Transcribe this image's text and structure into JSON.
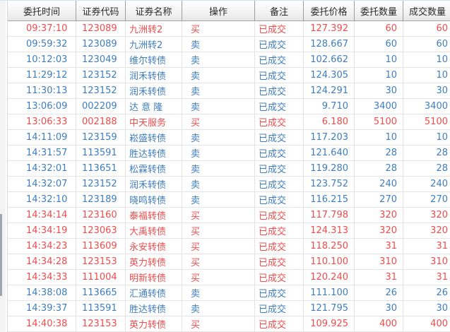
{
  "colors": {
    "buy_red": "#ef4c4c",
    "sell_blue": "#3e7dbd",
    "header_text": "#2a2a2a",
    "row_border": "#e5e5e5"
  },
  "table": {
    "columns": [
      "委托时间",
      "证券代码",
      "证券名称",
      "操作",
      "备注",
      "委托价格",
      "委托数量",
      "成交数量"
    ],
    "rows": [
      {
        "time": "09:37:10",
        "code": "123089",
        "name": "九洲转2",
        "action": "买",
        "note": "已成交",
        "price": "127.392",
        "qty": "60",
        "filled": "60",
        "direction": "buy"
      },
      {
        "time": "09:59:32",
        "code": "123089",
        "name": "九洲转2",
        "action": "卖",
        "note": "已成交",
        "price": "128.667",
        "qty": "60",
        "filled": "60",
        "direction": "sell"
      },
      {
        "time": "10:12:03",
        "code": "123049",
        "name": "维尔转债",
        "action": "卖",
        "note": "已成交",
        "price": "102.662",
        "qty": "10",
        "filled": "10",
        "direction": "sell"
      },
      {
        "time": "11:29:12",
        "code": "123152",
        "name": "润禾转债",
        "action": "卖",
        "note": "已成交",
        "price": "124.305",
        "qty": "10",
        "filled": "10",
        "direction": "sell"
      },
      {
        "time": "11:30:13",
        "code": "123152",
        "name": "润禾转债",
        "action": "卖",
        "note": "已成交",
        "price": "124.291",
        "qty": "30",
        "filled": "30",
        "direction": "sell"
      },
      {
        "time": "13:06:09",
        "code": "002209",
        "name": "达 意 隆",
        "action": "卖",
        "note": "已成交",
        "price": "9.710",
        "qty": "3400",
        "filled": "3400",
        "direction": "sell"
      },
      {
        "time": "13:06:33",
        "code": "002188",
        "name": "中天服务",
        "action": "买",
        "note": "已成交",
        "price": "6.180",
        "qty": "5100",
        "filled": "5100",
        "direction": "buy"
      },
      {
        "time": "14:11:09",
        "code": "123159",
        "name": "崧盛转债",
        "action": "卖",
        "note": "已成交",
        "price": "117.203",
        "qty": "10",
        "filled": "10",
        "direction": "sell"
      },
      {
        "time": "14:31:57",
        "code": "113591",
        "name": "胜达转债",
        "action": "卖",
        "note": "已成交",
        "price": "121.640",
        "qty": "28",
        "filled": "28",
        "direction": "sell"
      },
      {
        "time": "14:32:01",
        "code": "113651",
        "name": "松霖转债",
        "action": "卖",
        "note": "已成交",
        "price": "119.280",
        "qty": "28",
        "filled": "28",
        "direction": "sell"
      },
      {
        "time": "14:32:07",
        "code": "123152",
        "name": "润禾转债",
        "action": "卖",
        "note": "已成交",
        "price": "123.752",
        "qty": "240",
        "filled": "240",
        "direction": "sell"
      },
      {
        "time": "14:32:10",
        "code": "123189",
        "name": "晓鸣转债",
        "action": "卖",
        "note": "已成交",
        "price": "116.215",
        "qty": "270",
        "filled": "270",
        "direction": "sell"
      },
      {
        "time": "14:34:14",
        "code": "123160",
        "name": "泰福转债",
        "action": "买",
        "note": "已成交",
        "price": "117.798",
        "qty": "320",
        "filled": "320",
        "direction": "buy"
      },
      {
        "time": "14:34:19",
        "code": "123063",
        "name": "大禹转债",
        "action": "买",
        "note": "已成交",
        "price": "124.313",
        "qty": "320",
        "filled": "320",
        "direction": "buy"
      },
      {
        "time": "14:34:23",
        "code": "113609",
        "name": "永安转债",
        "action": "买",
        "note": "已成交",
        "price": "118.250",
        "qty": "31",
        "filled": "31",
        "direction": "buy"
      },
      {
        "time": "14:34:28",
        "code": "123153",
        "name": "英力转债",
        "action": "买",
        "note": "已成交",
        "price": "110.100",
        "qty": "310",
        "filled": "310",
        "direction": "buy"
      },
      {
        "time": "14:34:33",
        "code": "111004",
        "name": "明新转债",
        "action": "买",
        "note": "已成交",
        "price": "120.240",
        "qty": "31",
        "filled": "31",
        "direction": "buy"
      },
      {
        "time": "14:38:08",
        "code": "113665",
        "name": "汇通转债",
        "action": "卖",
        "note": "已成交",
        "price": "111.100",
        "qty": "26",
        "filled": "26",
        "direction": "sell"
      },
      {
        "time": "14:39:37",
        "code": "113591",
        "name": "胜达转债",
        "action": "卖",
        "note": "已成交",
        "price": "121.795",
        "qty": "30",
        "filled": "30",
        "direction": "sell"
      },
      {
        "time": "14:40:38",
        "code": "123153",
        "name": "英力转债",
        "action": "买",
        "note": "已成交",
        "price": "109.925",
        "qty": "400",
        "filled": "400",
        "direction": "buy"
      }
    ]
  }
}
